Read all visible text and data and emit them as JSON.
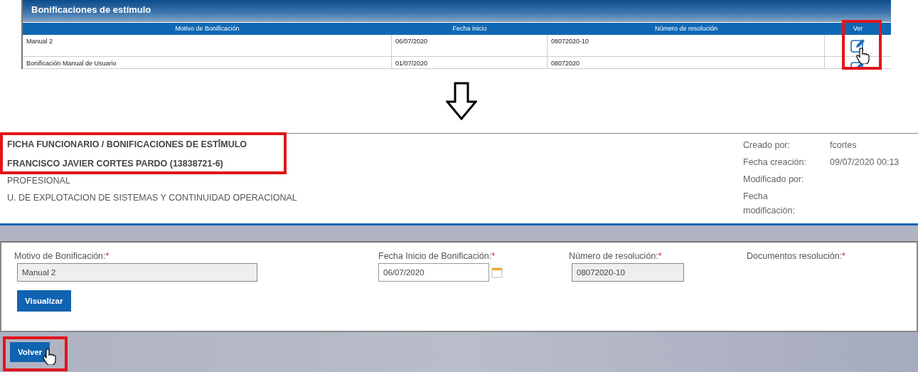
{
  "list_panel": {
    "title": "Bonificaciones de estímulo",
    "columns": [
      "Motivo de Bonificación",
      "Fecha inicio",
      "Número de resolución",
      "Ver"
    ],
    "rows": [
      {
        "cells": [
          "Manual 2",
          "06/07/2020",
          "08072020-10"
        ]
      },
      {
        "cells": [
          "Bonificación Manual de Usuario",
          "01/07/2020",
          "08072020"
        ]
      }
    ]
  },
  "detail": {
    "breadcrumb": [
      {
        "text": "FICHA FUNCIONARIO"
      },
      {
        "text": "/"
      },
      {
        "text": "BONIFICACIONES DE ESTĪMULO"
      }
    ],
    "employee": "FRANCISCO JAVIER CORTES PARDO (13838721-6)",
    "position": "PROFESIONAL",
    "unit": "U. DE EXPLOTACION DE SISTEMAS Y CONTINUIDAD OPERACIONAL",
    "meta": [
      {
        "label": "Creado por:",
        "value": "fcortes"
      },
      {
        "label": "Fecha creación:",
        "value": "09/07/2020 00:13"
      },
      {
        "label": "Modificado por:"
      },
      {
        "label": "Fecha modificación:"
      }
    ]
  },
  "form": {
    "fields": [
      {
        "kind": "text",
        "label": "Motivo de Bonificación:",
        "required_mark": "*",
        "value": "Manual 2",
        "readonly": true
      },
      {
        "kind": "date",
        "label": "Fecha Inicio de Bonificación:",
        "required_mark": "*",
        "value": "06/07/2020",
        "readonly": false
      },
      {
        "kind": "text",
        "label": "Número de resolución:",
        "required_mark": "*",
        "value": "08072020-10",
        "readonly": true
      },
      {
        "kind": "file",
        "label": "Documentos resolución:",
        "required_mark": "*"
      }
    ],
    "buttons": [
      "Visualizar"
    ]
  },
  "footer_buttons": [
    "Volver"
  ]
}
